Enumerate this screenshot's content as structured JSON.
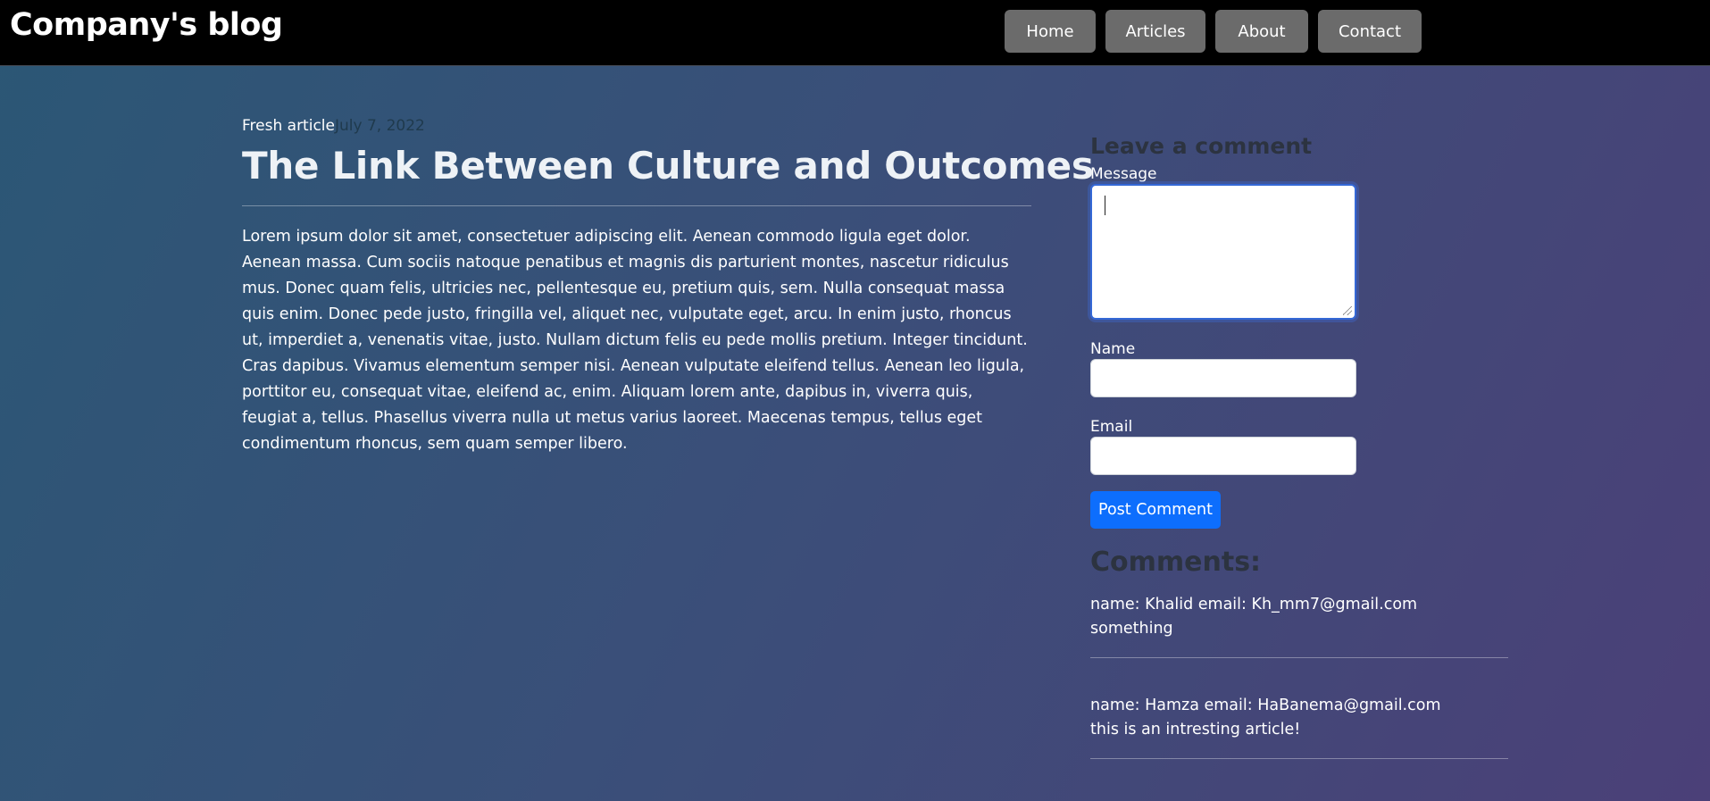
{
  "header": {
    "brand": "Company's blog",
    "nav": [
      {
        "label": "Home"
      },
      {
        "label": "Articles"
      },
      {
        "label": "About"
      },
      {
        "label": "Contact"
      }
    ]
  },
  "article": {
    "tag": "Fresh article",
    "date": "July 7, 2022",
    "title": "The Link Between Culture and Outcomes",
    "body": "Lorem ipsum dolor sit amet, consectetuer adipiscing elit. Aenean commodo ligula eget dolor. Aenean massa. Cum sociis natoque penatibus et magnis dis parturient montes, nascetur ridiculus mus. Donec quam felis, ultricies nec, pellentesque eu, pretium quis, sem. Nulla consequat massa quis enim. Donec pede justo, fringilla vel, aliquet nec, vulputate eget, arcu. In enim justo, rhoncus ut, imperdiet a, venenatis vitae, justo. Nullam dictum felis eu pede mollis pretium. Integer tincidunt. Cras dapibus. Vivamus elementum semper nisi. Aenean vulputate eleifend tellus. Aenean leo ligula, porttitor eu, consequat vitae, eleifend ac, enim. Aliquam lorem ante, dapibus in, viverra quis, feugiat a, tellus. Phasellus viverra nulla ut metus varius laoreet. Maecenas tempus, tellus eget condimentum rhoncus, sem quam semper libero."
  },
  "comment_form": {
    "heading": "Leave a comment",
    "message_label": "Message",
    "message_value": "",
    "name_label": "Name",
    "name_value": "",
    "email_label": "Email",
    "email_value": "",
    "submit_label": "Post Comment"
  },
  "comments": {
    "heading": "Comments:",
    "items": [
      {
        "meta": "name: Khalid email: Kh_mm7@gmail.com",
        "text": "something"
      },
      {
        "meta": "name: Hamza email: HaBanema@gmail.com",
        "text": "this is an intresting article!"
      }
    ]
  },
  "colors": {
    "accent": "#0d6efd",
    "nav_button": "#6b6b6b",
    "topbar": "#000000"
  }
}
